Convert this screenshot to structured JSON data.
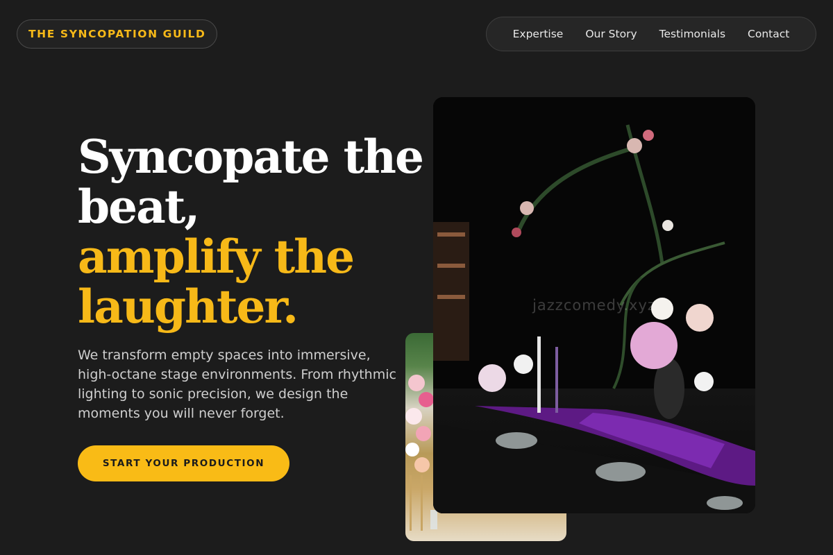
{
  "brand": {
    "name": "THE SYNCOPATION GUILD",
    "accent_color": "#f7b918"
  },
  "nav": {
    "items": [
      {
        "label": "Expertise"
      },
      {
        "label": "Our Story"
      },
      {
        "label": "Testimonials"
      },
      {
        "label": "Contact"
      }
    ]
  },
  "hero": {
    "headline_lines": [
      "Syncopate the",
      "beat,"
    ],
    "headline_accent_lines": [
      "amplify the",
      "laughter."
    ],
    "subtext": "We transform empty spaces into immersive, high-octane stage environments. From rhythmic lighting to sonic precision, we design the moments you will never forget.",
    "cta_label": "START YOUR PRODUCTION"
  },
  "gallery": {
    "main_watermark": "jazzcomedy.xyz",
    "main_image_subject": "dark banquet table with floral centerpieces and purple linens",
    "back_image_subject": "bright wedding aisle with pink and white flowers"
  },
  "colors": {
    "background": "#1c1c1c",
    "cta": "#f9bb16",
    "headline": "#ffffff"
  }
}
